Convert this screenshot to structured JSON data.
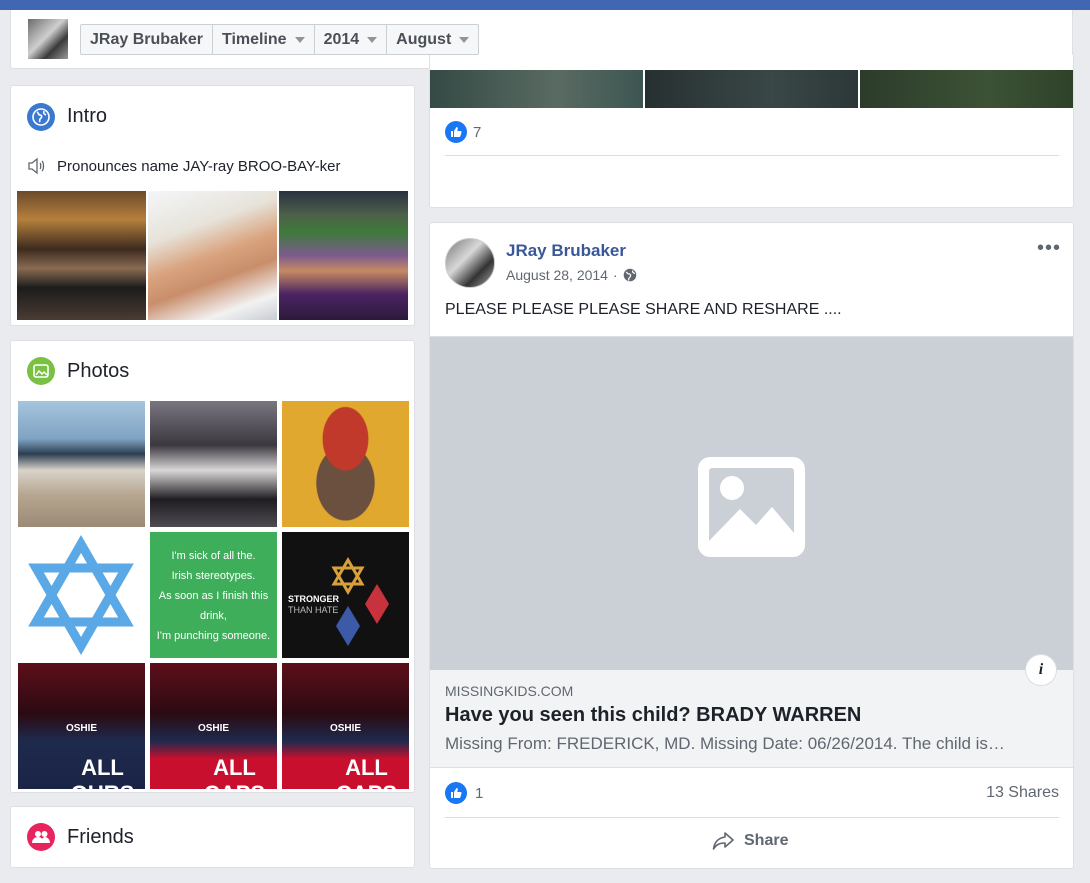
{
  "header": {
    "breadcrumbs": [
      {
        "label": "JRay Brubaker",
        "has_caret": false
      },
      {
        "label": "Timeline",
        "has_caret": true
      },
      {
        "label": "2014",
        "has_caret": true
      },
      {
        "label": "August",
        "has_caret": true
      }
    ]
  },
  "intro": {
    "title": "Intro",
    "icon": "globe-icon",
    "pronounce_text": "Pronounces name JAY-ray BROO-BAY-ker",
    "pronounce_icon": "speaker-icon",
    "photos": [
      "friends-shirt-photo",
      "selfie-photo",
      "stadium-photo"
    ]
  },
  "photos": {
    "title": "Photos",
    "icon": "photo-icon",
    "grid_texts": {
      "irish": [
        "I'm sick of all the.",
        "Irish stereotypes.",
        "As soon as I finish this drink,",
        "I'm punching someone."
      ],
      "stronger_1": "STRONGER",
      "stronger_2": "THAN HATE",
      "caps_1": "ALL OURS",
      "caps_2": "ALL CAPS",
      "caps_3": "ALL CAPS",
      "jersey": "OSHIE"
    }
  },
  "friends": {
    "title": "Friends",
    "icon": "friends-icon"
  },
  "previous_post": {
    "likes": "7"
  },
  "post": {
    "author": "JRay Brubaker",
    "date": "August 28, 2014",
    "privacy_icon": "globe-icon",
    "more": "•••",
    "text": "PLEASE PLEASE PLEASE SHARE AND RESHARE ....",
    "link": {
      "domain": "MISSINGKIDS.COM",
      "title": "Have you seen this child? BRADY WARREN",
      "description": "Missing From: FREDERICK, MD. Missing Date: 06/26/2014. The child is…"
    },
    "info_label": "i",
    "likes": "1",
    "shares": "13 Shares",
    "share_label": "Share"
  },
  "colors": {
    "brand_blue": "#4267b2",
    "link_blue": "#385898",
    "like_blue": "#1877f2",
    "photos_green": "#7ac143",
    "friends_pink": "#e8245f"
  }
}
